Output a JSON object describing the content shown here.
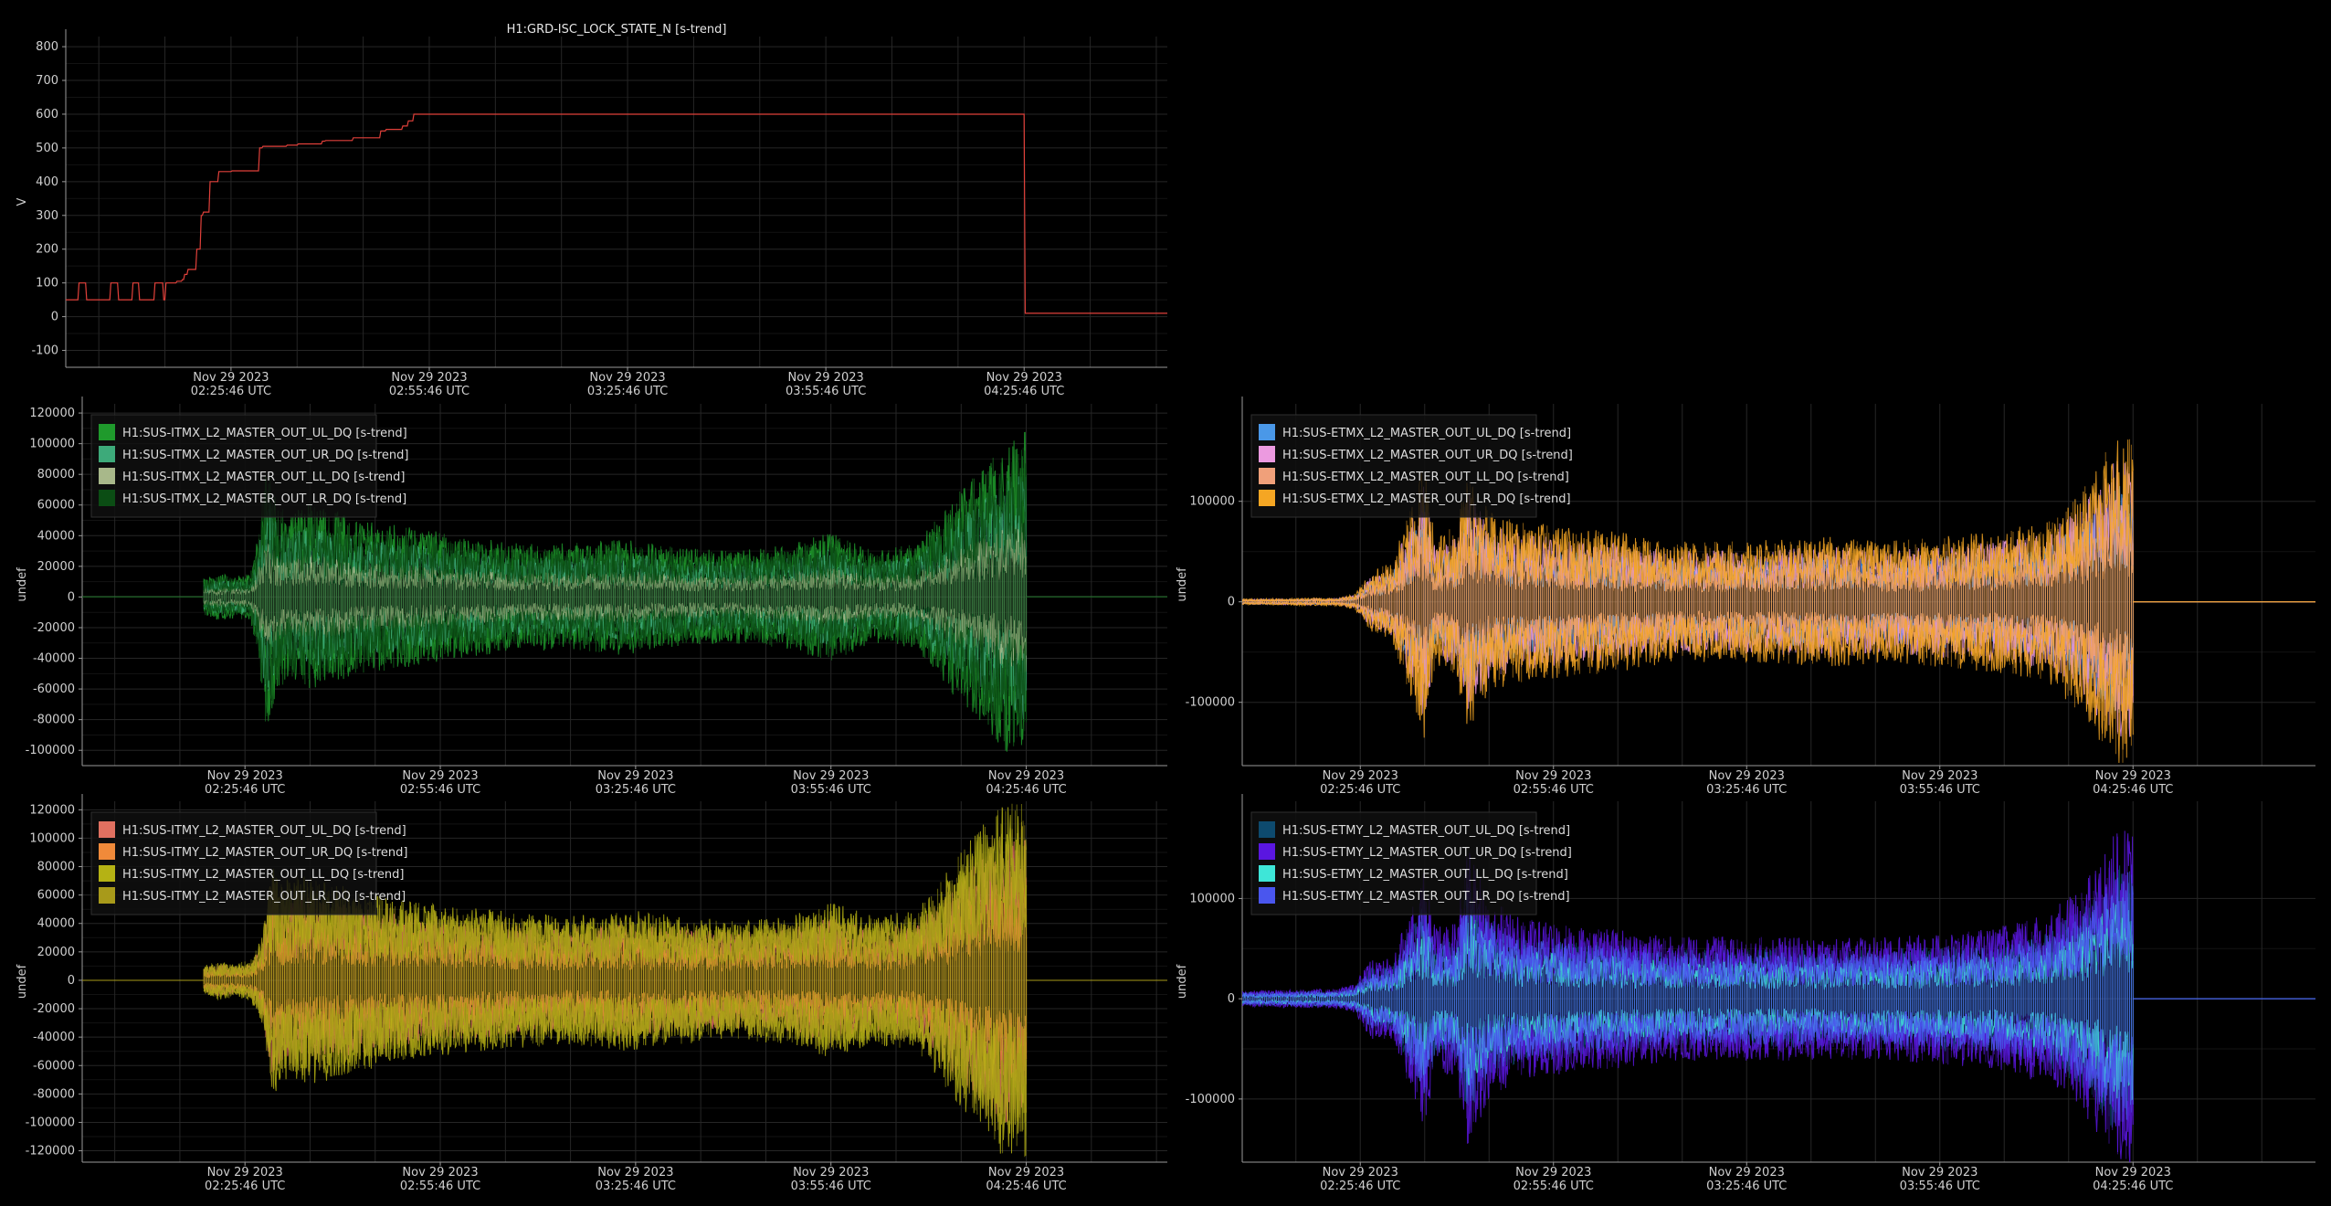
{
  "chart_data": [
    {
      "id": "lock",
      "type": "line",
      "title": "H1:GRD-ISC_LOCK_STATE_N [s-trend]",
      "ylabel": "V",
      "ylim": [
        -150,
        830
      ],
      "yticks": [
        -100,
        0,
        100,
        200,
        300,
        400,
        500,
        600,
        700,
        800
      ],
      "ytick_labels": [
        "-100",
        "0",
        "100",
        "200",
        "300",
        "400",
        "500",
        "600",
        "700",
        "800"
      ],
      "xlim": [
        0,
        10000
      ],
      "xticks": [
        1500,
        3300,
        5100,
        6900,
        8700
      ],
      "xtick_labels": [
        [
          "Nov 29 2023",
          "02:25:46 UTC"
        ],
        [
          "Nov 29 2023",
          "02:55:46 UTC"
        ],
        [
          "Nov 29 2023",
          "03:25:46 UTC"
        ],
        [
          "Nov 29 2023",
          "03:55:46 UTC"
        ],
        [
          "Nov 29 2023",
          "04:25:46 UTC"
        ]
      ],
      "x": [
        0,
        110,
        120,
        180,
        190,
        400,
        410,
        470,
        480,
        600,
        610,
        660,
        670,
        800,
        810,
        880,
        890,
        900,
        910,
        1000,
        1010,
        1050,
        1060,
        1070,
        1080,
        1100,
        1110,
        1180,
        1190,
        1220,
        1230,
        1240,
        1250,
        1300,
        1310,
        1380,
        1390,
        1500,
        1510,
        1750,
        1760,
        1780,
        1790,
        2000,
        2010,
        2100,
        2110,
        2320,
        2330,
        2350,
        2360,
        2600,
        2610,
        2850,
        2860,
        2900,
        2910,
        3050,
        3060,
        3100,
        3110,
        3150,
        3160,
        8700,
        8710,
        10000
      ],
      "series": [
        {
          "color": "#e0403a",
          "values": [
            50,
            50,
            100,
            100,
            50,
            50,
            100,
            100,
            50,
            50,
            100,
            100,
            50,
            50,
            100,
            100,
            50,
            50,
            100,
            100,
            105,
            105,
            110,
            110,
            125,
            125,
            140,
            140,
            200,
            200,
            300,
            300,
            310,
            310,
            400,
            400,
            430,
            430,
            432,
            432,
            500,
            500,
            505,
            505,
            508,
            508,
            512,
            512,
            520,
            520,
            522,
            522,
            530,
            530,
            550,
            550,
            555,
            555,
            565,
            565,
            580,
            580,
            600,
            600,
            10,
            10
          ]
        }
      ]
    },
    {
      "id": "itmx",
      "type": "line",
      "ylabel": "undef",
      "ylim": [
        -110000,
        126000
      ],
      "yticks": [
        -100000,
        -80000,
        -60000,
        -40000,
        -20000,
        0,
        20000,
        40000,
        60000,
        80000,
        100000,
        120000
      ],
      "ytick_labels": [
        "-100000",
        "-80000",
        "-60000",
        "-40000",
        "-20000",
        "0",
        "20000",
        "40000",
        "60000",
        "80000",
        "100000",
        "120000"
      ],
      "xlim": [
        0,
        10000
      ],
      "xticks": [
        1500,
        3300,
        5100,
        6900,
        8700
      ],
      "xtick_labels": [
        [
          "Nov 29 2023",
          "02:25:46 UTC"
        ],
        [
          "Nov 29 2023",
          "02:55:46 UTC"
        ],
        [
          "Nov 29 2023",
          "03:25:46 UTC"
        ],
        [
          "Nov 29 2023",
          "03:55:46 UTC"
        ],
        [
          "Nov 29 2023",
          "04:25:46 UTC"
        ]
      ],
      "signal_range": [
        1120,
        8700
      ],
      "envelope": {
        "x": [
          1120,
          1250,
          1400,
          1550,
          1620,
          1700,
          1800,
          1900,
          2100,
          2300,
          2500,
          2800,
          3100,
          3500,
          4000,
          4500,
          5000,
          5500,
          6000,
          6500,
          6900,
          7300,
          7700,
          7900,
          8100,
          8300,
          8500,
          8700
        ],
        "amp": [
          12000,
          15000,
          14000,
          15000,
          40000,
          90000,
          60000,
          55000,
          62000,
          58000,
          50000,
          48000,
          45000,
          40000,
          35000,
          35000,
          38000,
          32000,
          30000,
          34000,
          42000,
          30000,
          35000,
          55000,
          70000,
          85000,
          100000,
          110000
        ]
      },
      "series": [
        {
          "name": "H1:SUS-ITMX_L2_MASTER_OUT_UL_DQ [s-trend]",
          "color": "#1f9a2c",
          "scale": 1.0
        },
        {
          "name": "H1:SUS-ITMX_L2_MASTER_OUT_UR_DQ [s-trend]",
          "color": "#3daa7a",
          "scale": 0.75
        },
        {
          "name": "H1:SUS-ITMX_L2_MASTER_OUT_LL_DQ [s-trend]",
          "color": "#a8b88a",
          "scale": 0.45
        },
        {
          "name": "H1:SUS-ITMX_L2_MASTER_OUT_LR_DQ [s-trend]",
          "color": "#0b4d14",
          "scale": 0.9
        }
      ]
    },
    {
      "id": "etmx",
      "type": "line",
      "ylabel": "undef",
      "ylim": [
        -163000,
        197000
      ],
      "yticks": [
        -100000,
        0,
        100000
      ],
      "ytick_labels": [
        "-100000",
        "0",
        "100000"
      ],
      "xlim": [
        0,
        10000
      ],
      "xticks": [
        1100,
        2900,
        4700,
        6500,
        8300
      ],
      "xtick_labels": [
        [
          "Nov 29 2023",
          "02:25:46 UTC"
        ],
        [
          "Nov 29 2023",
          "02:55:46 UTC"
        ],
        [
          "Nov 29 2023",
          "03:25:46 UTC"
        ],
        [
          "Nov 29 2023",
          "03:55:46 UTC"
        ],
        [
          "Nov 29 2023",
          "04:25:46 UTC"
        ]
      ],
      "signal_range": [
        0,
        8300
      ],
      "envelope": {
        "x": [
          0,
          900,
          1050,
          1200,
          1400,
          1700,
          1800,
          2000,
          2100,
          2300,
          2600,
          3000,
          3500,
          4000,
          4500,
          5000,
          5500,
          6000,
          6500,
          7000,
          7500,
          7800,
          8000,
          8150,
          8300
        ],
        "amp": [
          3000,
          4000,
          8000,
          30000,
          40000,
          140000,
          60000,
          80000,
          130000,
          90000,
          80000,
          75000,
          70000,
          60000,
          60000,
          62000,
          65000,
          60000,
          65000,
          70000,
          80000,
          110000,
          140000,
          170000,
          160000
        ]
      },
      "series": [
        {
          "name": "H1:SUS-ETMX_L2_MASTER_OUT_UL_DQ [s-trend]",
          "color": "#4a98e8",
          "scale": 0.7
        },
        {
          "name": "H1:SUS-ETMX_L2_MASTER_OUT_UR_DQ [s-trend]",
          "color": "#ec9ae0",
          "scale": 0.85
        },
        {
          "name": "H1:SUS-ETMX_L2_MASTER_OUT_LL_DQ [s-trend]",
          "color": "#f0a07a",
          "scale": 0.6
        },
        {
          "name": "H1:SUS-ETMX_L2_MASTER_OUT_LR_DQ [s-trend]",
          "color": "#f5a623",
          "scale": 1.0
        }
      ]
    },
    {
      "id": "itmy",
      "type": "line",
      "ylabel": "undef",
      "ylim": [
        -128000,
        126000
      ],
      "yticks": [
        -120000,
        -100000,
        -80000,
        -60000,
        -40000,
        -20000,
        0,
        20000,
        40000,
        60000,
        80000,
        100000,
        120000
      ],
      "ytick_labels": [
        "-120000",
        "-100000",
        "-80000",
        "-60000",
        "-40000",
        "-20000",
        "0",
        "20000",
        "40000",
        "60000",
        "80000",
        "100000",
        "120000"
      ],
      "xlim": [
        0,
        10000
      ],
      "xticks": [
        1500,
        3300,
        5100,
        6900,
        8700
      ],
      "xtick_labels": [
        [
          "Nov 29 2023",
          "02:25:46 UTC"
        ],
        [
          "Nov 29 2023",
          "02:55:46 UTC"
        ],
        [
          "Nov 29 2023",
          "03:25:46 UTC"
        ],
        [
          "Nov 29 2023",
          "03:55:46 UTC"
        ],
        [
          "Nov 29 2023",
          "04:25:46 UTC"
        ]
      ],
      "signal_range": [
        1120,
        8700
      ],
      "envelope": {
        "x": [
          1120,
          1250,
          1400,
          1550,
          1650,
          1750,
          1850,
          2000,
          2200,
          2500,
          2800,
          3100,
          3500,
          4000,
          4500,
          5000,
          5500,
          6000,
          6500,
          6900,
          7300,
          7700,
          7900,
          8100,
          8300,
          8500,
          8700
        ],
        "amp": [
          10000,
          14000,
          12000,
          14000,
          30000,
          85000,
          70000,
          75000,
          72000,
          65000,
          60000,
          55000,
          52000,
          48000,
          45000,
          50000,
          45000,
          42000,
          45000,
          55000,
          45000,
          50000,
          70000,
          90000,
          110000,
          125000,
          125000
        ]
      },
      "series": [
        {
          "name": "H1:SUS-ITMY_L2_MASTER_OUT_UL_DQ [s-trend]",
          "color": "#e07060",
          "scale": 0.8
        },
        {
          "name": "H1:SUS-ITMY_L2_MASTER_OUT_UR_DQ [s-trend]",
          "color": "#f08a3a",
          "scale": 0.6
        },
        {
          "name": "H1:SUS-ITMY_L2_MASTER_OUT_LL_DQ [s-trend]",
          "color": "#b5b214",
          "scale": 1.0
        },
        {
          "name": "H1:SUS-ITMY_L2_MASTER_OUT_LR_DQ [s-trend]",
          "color": "#a89a1a",
          "scale": 0.9
        }
      ]
    },
    {
      "id": "etmy",
      "type": "line",
      "ylabel": "undef",
      "ylim": [
        -163000,
        197000
      ],
      "yticks": [
        -100000,
        0,
        100000
      ],
      "ytick_labels": [
        "-100000",
        "0",
        "100000"
      ],
      "xlim": [
        0,
        10000
      ],
      "xticks": [
        1100,
        2900,
        4700,
        6500,
        8300
      ],
      "xtick_labels": [
        [
          "Nov 29 2023",
          "02:25:46 UTC"
        ],
        [
          "Nov 29 2023",
          "02:55:46 UTC"
        ],
        [
          "Nov 29 2023",
          "03:25:46 UTC"
        ],
        [
          "Nov 29 2023",
          "03:55:46 UTC"
        ],
        [
          "Nov 29 2023",
          "04:25:46 UTC"
        ]
      ],
      "signal_range": [
        0,
        8300
      ],
      "envelope": {
        "x": [
          0,
          900,
          1050,
          1200,
          1400,
          1700,
          1800,
          2000,
          2100,
          2300,
          2600,
          3000,
          3500,
          4000,
          4500,
          5000,
          5500,
          6000,
          6500,
          7000,
          7500,
          7800,
          8000,
          8150,
          8300
        ],
        "amp": [
          8000,
          10000,
          15000,
          40000,
          40000,
          130000,
          70000,
          80000,
          150000,
          100000,
          80000,
          75000,
          70000,
          62000,
          62000,
          62000,
          60000,
          62000,
          65000,
          70000,
          85000,
          110000,
          140000,
          170000,
          170000
        ]
      },
      "series": [
        {
          "name": "H1:SUS-ETMY_L2_MASTER_OUT_UL_DQ [s-trend]",
          "color": "#0d4a6e",
          "scale": 0.8
        },
        {
          "name": "H1:SUS-ETMY_L2_MASTER_OUT_UR_DQ [s-trend]",
          "color": "#5a16e0",
          "scale": 1.0
        },
        {
          "name": "H1:SUS-ETMY_L2_MASTER_OUT_LL_DQ [s-trend]",
          "color": "#3ee6d8",
          "scale": 0.6
        },
        {
          "name": "H1:SUS-ETMY_L2_MASTER_OUT_LR_DQ [s-trend]",
          "color": "#4a56ee",
          "scale": 0.75
        }
      ]
    }
  ]
}
